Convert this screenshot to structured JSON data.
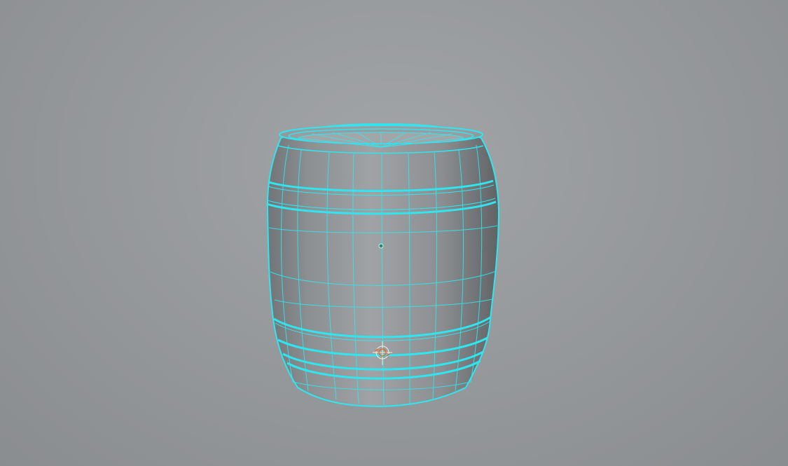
{
  "viewport": {
    "background_color": "#979a9c",
    "mesh": {
      "object": "barrel",
      "wire_color": "#2fe6f0",
      "surface_color": "#8e9193",
      "selected": true
    },
    "icons": {
      "pivot": "object-pivot-icon",
      "manipulator": "move-manipulator-icon"
    }
  }
}
